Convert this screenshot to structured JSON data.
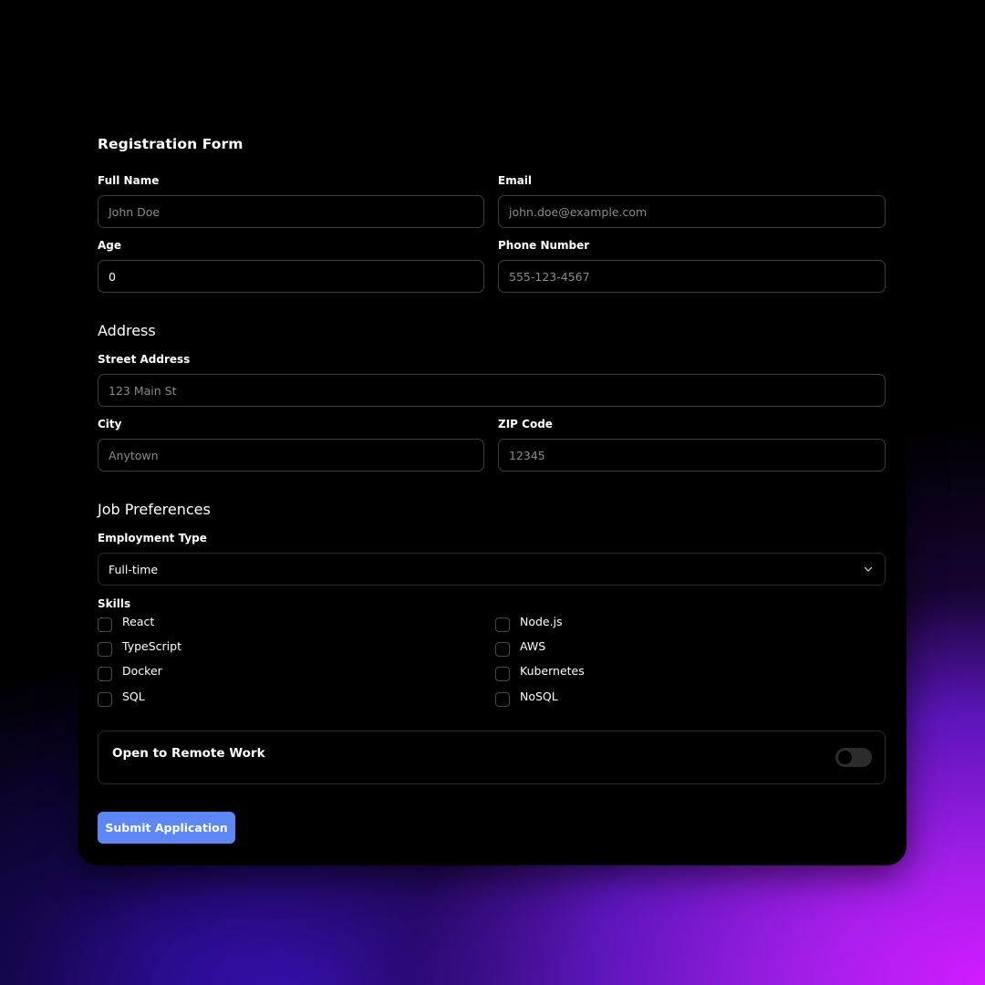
{
  "form": {
    "title": "Registration Form",
    "full_name": {
      "label": "Full Name",
      "placeholder": "John Doe"
    },
    "email": {
      "label": "Email",
      "placeholder": "john.doe@example.com"
    },
    "age": {
      "label": "Age",
      "value": "0"
    },
    "phone": {
      "label": "Phone Number",
      "placeholder": "555-123-4567"
    }
  },
  "address": {
    "title": "Address",
    "street": {
      "label": "Street Address",
      "placeholder": "123 Main St"
    },
    "city": {
      "label": "City",
      "placeholder": "Anytown"
    },
    "zip": {
      "label": "ZIP Code",
      "placeholder": "12345"
    }
  },
  "job": {
    "title": "Job Preferences",
    "employment_type": {
      "label": "Employment Type",
      "value": "Full-time",
      "icon": "chevron-down-icon"
    },
    "skills_label": "Skills",
    "skills": [
      {
        "label": "React",
        "checked": false
      },
      {
        "label": "Node.js",
        "checked": false
      },
      {
        "label": "TypeScript",
        "checked": false
      },
      {
        "label": "AWS",
        "checked": false
      },
      {
        "label": "Docker",
        "checked": false
      },
      {
        "label": "Kubernetes",
        "checked": false
      },
      {
        "label": "SQL",
        "checked": false
      },
      {
        "label": "NoSQL",
        "checked": false
      }
    ],
    "remote": {
      "label": "Open to Remote Work",
      "enabled": false
    }
  },
  "submit_label": "Submit Application",
  "colors": {
    "accent": "#5c87f4",
    "background_gradient": [
      "#000000",
      "#3a12c8",
      "#d21cff"
    ],
    "card": "#000000",
    "border": "#3c3c3c"
  }
}
